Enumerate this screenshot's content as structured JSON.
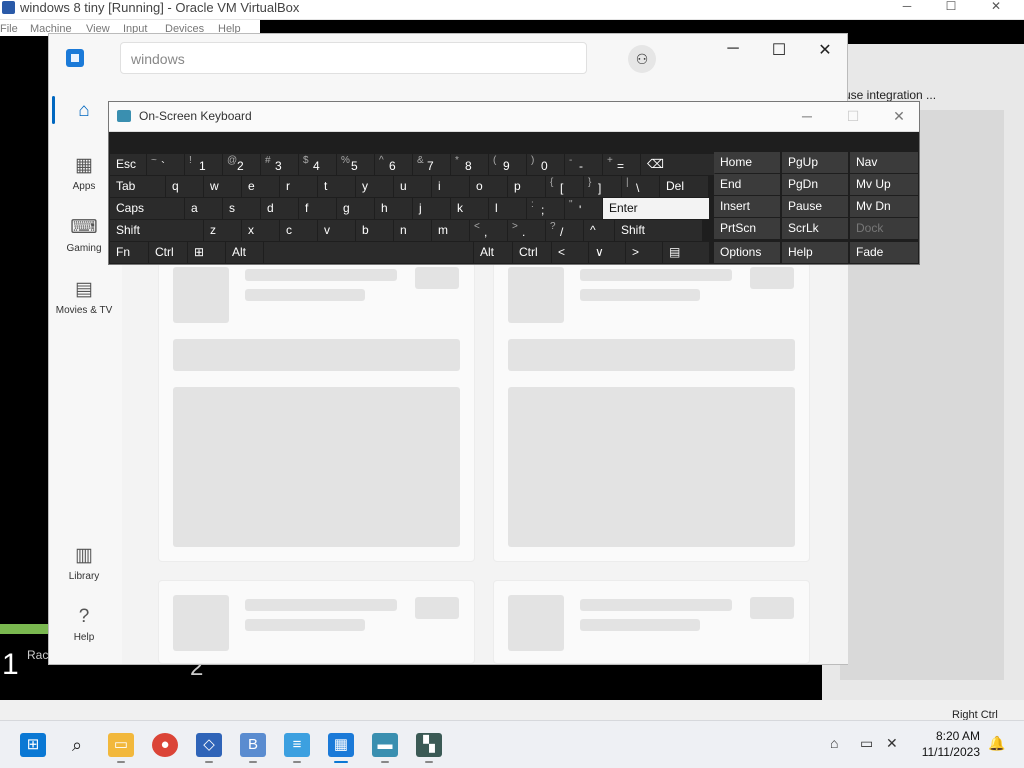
{
  "host_window": {
    "title": "windows 8 tiny [Running] - Oracle VM VirtualBox",
    "menu": [
      "File",
      "Machine",
      "View",
      "Input",
      "Devices",
      "Help"
    ],
    "controls": [
      "─",
      "☐",
      "✕"
    ]
  },
  "guest_right": {
    "label": "use integration ...",
    "status_right": "Right Ctrl"
  },
  "guest_bottom_left": {
    "num": "1",
    "text": "Rac",
    "num2": "2"
  },
  "store": {
    "search_placeholder": "windows",
    "user_icon": "⚇",
    "controls": [
      "─",
      "☐",
      "✕"
    ],
    "nav": [
      {
        "label": "Home",
        "icon": "home-icon"
      },
      {
        "label": "Apps",
        "icon": "apps-icon"
      },
      {
        "label": "Gaming",
        "icon": "gamepad-icon"
      },
      {
        "label": "Movies & TV",
        "icon": "clapper-icon"
      },
      {
        "label": "Library",
        "icon": "library-icon"
      },
      {
        "label": "Help",
        "icon": "help-icon"
      }
    ]
  },
  "osk": {
    "title": "On-Screen Keyboard",
    "row1": [
      {
        "label": "Esc"
      },
      {
        "shift": "~",
        "main": "`"
      },
      {
        "shift": "!",
        "main": "1"
      },
      {
        "shift": "@",
        "main": "2"
      },
      {
        "shift": "#",
        "main": "3"
      },
      {
        "shift": "$",
        "main": "4"
      },
      {
        "shift": "%",
        "main": "5"
      },
      {
        "shift": "^",
        "main": "6"
      },
      {
        "shift": "&",
        "main": "7"
      },
      {
        "shift": "*",
        "main": "8"
      },
      {
        "shift": "(",
        "main": "9"
      },
      {
        "shift": ")",
        "main": "0"
      },
      {
        "shift": "-",
        "main": "-"
      },
      {
        "shift": "+",
        "main": "="
      },
      {
        "label": "⌫"
      }
    ],
    "row2": [
      "Tab",
      "q",
      "w",
      "e",
      "r",
      "t",
      "y",
      "u",
      "i",
      "o",
      "p"
    ],
    "row2_extra": [
      {
        "shift": "{",
        "main": "["
      },
      {
        "shift": "}",
        "main": "]"
      },
      {
        "shift": "|",
        "main": "\\"
      },
      {
        "label": "Del"
      }
    ],
    "row3": [
      "Caps",
      "a",
      "s",
      "d",
      "f",
      "g",
      "h",
      "j",
      "k",
      "l"
    ],
    "row3_extra": [
      {
        "shift": ":",
        "main": ";"
      },
      {
        "shift": "\"",
        "main": "'"
      },
      {
        "label": "Enter"
      }
    ],
    "row4": [
      "Shift",
      "z",
      "x",
      "c",
      "v",
      "b",
      "n",
      "m"
    ],
    "row4_extra": [
      {
        "shift": "<",
        "main": ","
      },
      {
        "shift": ">",
        "main": "."
      },
      {
        "shift": "?",
        "main": "/"
      },
      {
        "label": "^"
      },
      {
        "label": "Shift"
      }
    ],
    "row5": [
      "Fn",
      "Ctrl",
      "⊞",
      "Alt",
      "",
      "Alt",
      "Ctrl",
      "<",
      "∨",
      ">",
      "▤"
    ],
    "right": [
      [
        "Home",
        "PgUp",
        "Nav"
      ],
      [
        "End",
        "PgDn",
        "Mv Up"
      ],
      [
        "Insert",
        "Pause",
        "Mv Dn"
      ],
      [
        "PrtScn",
        "ScrLk",
        "Dock"
      ],
      [
        "Options",
        "Help",
        "Fade"
      ]
    ]
  },
  "taskbar": {
    "time": "8:20 AM",
    "date": "11/11/2023",
    "apps": [
      "start-icon",
      "search-icon",
      "file-explorer-icon",
      "chrome-icon",
      "virtualbox-icon",
      "code-blocks-icon",
      "notepad-icon",
      "store-icon",
      "terminal-icon",
      "app-icon"
    ]
  }
}
